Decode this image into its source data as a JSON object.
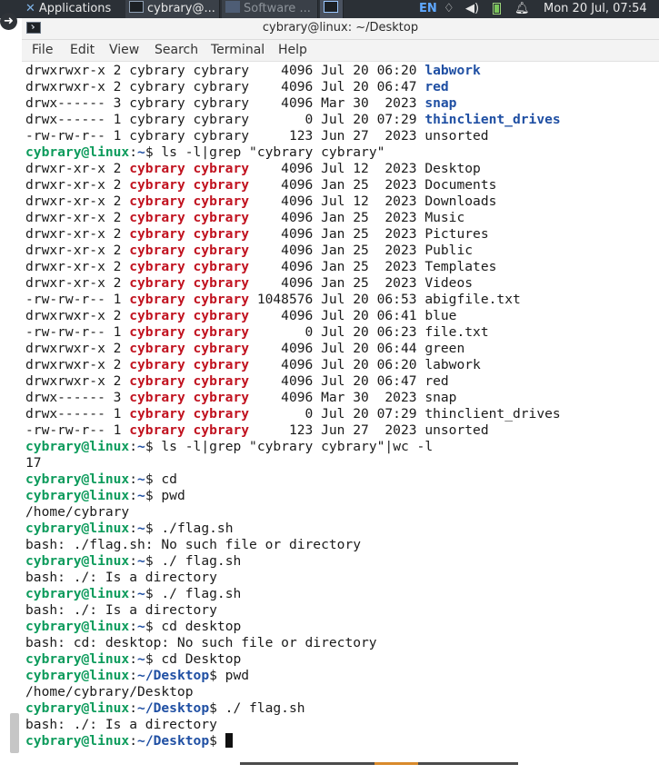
{
  "panel": {
    "applications_label": "Applications",
    "tasks": [
      {
        "label": "cybrary@..."
      },
      {
        "label": "Software ..."
      },
      {
        "label": ""
      }
    ],
    "keyboard_layout": "EN",
    "clock": "Mon 20 Jul, 07:54",
    "icons": [
      "xfce-logo-icon",
      "network-icon",
      "volume-icon",
      "battery-icon",
      "notification-bell-icon"
    ]
  },
  "window": {
    "title": "cybrary@linux: ~/Desktop",
    "menu": [
      "File",
      "Edit",
      "View",
      "Search",
      "Terminal",
      "Help"
    ]
  },
  "terminal": {
    "prompt_user": "cybrary@linux",
    "lines": [
      [
        {
          "t": "drwxrwxr-x 2 cybrary cybrary    4096 Jul 20 06:20 "
        },
        {
          "t": "labwork",
          "c": "dir"
        }
      ],
      [
        {
          "t": "drwxrwxr-x 2 cybrary cybrary    4096 Jul 20 06:47 "
        },
        {
          "t": "red",
          "c": "dir"
        }
      ],
      [
        {
          "t": "drwx------ 3 cybrary cybrary    4096 Mar 30  2023 "
        },
        {
          "t": "snap",
          "c": "dir"
        }
      ],
      [
        {
          "t": "drwx------ 1 cybrary cybrary       0 Jul 20 07:29 "
        },
        {
          "t": "thinclient_drives",
          "c": "dir"
        }
      ],
      [
        {
          "t": "-rw-rw-r-- 1 cybrary cybrary     123 Jun 27  2023 unsorted"
        }
      ],
      [
        {
          "t": "cybrary@linux",
          "c": "user"
        },
        {
          "t": ":"
        },
        {
          "t": "~",
          "c": "path"
        },
        {
          "t": "$ ls -l|grep \"cybrary cybrary\""
        }
      ],
      [
        {
          "t": "drwxr-xr-x 2 "
        },
        {
          "t": "cybrary cybrary",
          "c": "hl"
        },
        {
          "t": "    4096 Jul 12  2023 Desktop"
        }
      ],
      [
        {
          "t": "drwxr-xr-x 2 "
        },
        {
          "t": "cybrary cybrary",
          "c": "hl"
        },
        {
          "t": "    4096 Jan 25  2023 Documents"
        }
      ],
      [
        {
          "t": "drwxr-xr-x 2 "
        },
        {
          "t": "cybrary cybrary",
          "c": "hl"
        },
        {
          "t": "    4096 Jul 12  2023 Downloads"
        }
      ],
      [
        {
          "t": "drwxr-xr-x 2 "
        },
        {
          "t": "cybrary cybrary",
          "c": "hl"
        },
        {
          "t": "    4096 Jan 25  2023 Music"
        }
      ],
      [
        {
          "t": "drwxr-xr-x 2 "
        },
        {
          "t": "cybrary cybrary",
          "c": "hl"
        },
        {
          "t": "    4096 Jan 25  2023 Pictures"
        }
      ],
      [
        {
          "t": "drwxr-xr-x 2 "
        },
        {
          "t": "cybrary cybrary",
          "c": "hl"
        },
        {
          "t": "    4096 Jan 25  2023 Public"
        }
      ],
      [
        {
          "t": "drwxr-xr-x 2 "
        },
        {
          "t": "cybrary cybrary",
          "c": "hl"
        },
        {
          "t": "    4096 Jan 25  2023 Templates"
        }
      ],
      [
        {
          "t": "drwxr-xr-x 2 "
        },
        {
          "t": "cybrary cybrary",
          "c": "hl"
        },
        {
          "t": "    4096 Jan 25  2023 Videos"
        }
      ],
      [
        {
          "t": "-rw-rw-r-- 1 "
        },
        {
          "t": "cybrary cybrary",
          "c": "hl"
        },
        {
          "t": " 1048576 Jul 20 06:53 abigfile.txt"
        }
      ],
      [
        {
          "t": "drwxrwxr-x 2 "
        },
        {
          "t": "cybrary cybrary",
          "c": "hl"
        },
        {
          "t": "    4096 Jul 20 06:41 blue"
        }
      ],
      [
        {
          "t": "-rw-rw-r-- 1 "
        },
        {
          "t": "cybrary cybrary",
          "c": "hl"
        },
        {
          "t": "       0 Jul 20 06:23 file.txt"
        }
      ],
      [
        {
          "t": "drwxrwxr-x 2 "
        },
        {
          "t": "cybrary cybrary",
          "c": "hl"
        },
        {
          "t": "    4096 Jul 20 06:44 green"
        }
      ],
      [
        {
          "t": "drwxrwxr-x 2 "
        },
        {
          "t": "cybrary cybrary",
          "c": "hl"
        },
        {
          "t": "    4096 Jul 20 06:20 labwork"
        }
      ],
      [
        {
          "t": "drwxrwxr-x 2 "
        },
        {
          "t": "cybrary cybrary",
          "c": "hl"
        },
        {
          "t": "    4096 Jul 20 06:47 red"
        }
      ],
      [
        {
          "t": "drwx------ 3 "
        },
        {
          "t": "cybrary cybrary",
          "c": "hl"
        },
        {
          "t": "    4096 Mar 30  2023 snap"
        }
      ],
      [
        {
          "t": "drwx------ 1 "
        },
        {
          "t": "cybrary cybrary",
          "c": "hl"
        },
        {
          "t": "       0 Jul 20 07:29 thinclient_drives"
        }
      ],
      [
        {
          "t": "-rw-rw-r-- 1 "
        },
        {
          "t": "cybrary cybrary",
          "c": "hl"
        },
        {
          "t": "     123 Jun 27  2023 unsorted"
        }
      ],
      [
        {
          "t": "cybrary@linux",
          "c": "user"
        },
        {
          "t": ":"
        },
        {
          "t": "~",
          "c": "path"
        },
        {
          "t": "$ ls -l|grep \"cybrary cybrary\"|wc -l"
        }
      ],
      [
        {
          "t": "17"
        }
      ],
      [
        {
          "t": "cybrary@linux",
          "c": "user"
        },
        {
          "t": ":"
        },
        {
          "t": "~",
          "c": "path"
        },
        {
          "t": "$ cd"
        }
      ],
      [
        {
          "t": "cybrary@linux",
          "c": "user"
        },
        {
          "t": ":"
        },
        {
          "t": "~",
          "c": "path"
        },
        {
          "t": "$ pwd"
        }
      ],
      [
        {
          "t": "/home/cybrary"
        }
      ],
      [
        {
          "t": "cybrary@linux",
          "c": "user"
        },
        {
          "t": ":"
        },
        {
          "t": "~",
          "c": "path"
        },
        {
          "t": "$ ./flag.sh"
        }
      ],
      [
        {
          "t": "bash: ./flag.sh: No such file or directory"
        }
      ],
      [
        {
          "t": "cybrary@linux",
          "c": "user"
        },
        {
          "t": ":"
        },
        {
          "t": "~",
          "c": "path"
        },
        {
          "t": "$ ./ flag.sh"
        }
      ],
      [
        {
          "t": "bash: ./: Is a directory"
        }
      ],
      [
        {
          "t": "cybrary@linux",
          "c": "user"
        },
        {
          "t": ":"
        },
        {
          "t": "~",
          "c": "path"
        },
        {
          "t": "$ ./ flag.sh"
        }
      ],
      [
        {
          "t": "bash: ./: Is a directory"
        }
      ],
      [
        {
          "t": "cybrary@linux",
          "c": "user"
        },
        {
          "t": ":"
        },
        {
          "t": "~",
          "c": "path"
        },
        {
          "t": "$ cd desktop"
        }
      ],
      [
        {
          "t": "bash: cd: desktop: No such file or directory"
        }
      ],
      [
        {
          "t": "cybrary@linux",
          "c": "user"
        },
        {
          "t": ":"
        },
        {
          "t": "~",
          "c": "path"
        },
        {
          "t": "$ cd Desktop"
        }
      ],
      [
        {
          "t": "cybrary@linux",
          "c": "user"
        },
        {
          "t": ":"
        },
        {
          "t": "~/Desktop",
          "c": "path"
        },
        {
          "t": "$ pwd"
        }
      ],
      [
        {
          "t": "/home/cybrary/Desktop"
        }
      ],
      [
        {
          "t": "cybrary@linux",
          "c": "user"
        },
        {
          "t": ":"
        },
        {
          "t": "~/Desktop",
          "c": "path"
        },
        {
          "t": "$ ./ flag.sh"
        }
      ],
      [
        {
          "t": "bash: ./: Is a directory"
        }
      ],
      [
        {
          "t": "cybrary@linux",
          "c": "user"
        },
        {
          "t": ":"
        },
        {
          "t": "~/Desktop",
          "c": "path"
        },
        {
          "t": "$ "
        },
        {
          "cursor": true
        }
      ]
    ]
  },
  "colors": {
    "prompt_user": "#0d9b5c",
    "prompt_path": "#1f4fa3",
    "grep_match": "#c1121f",
    "panel_bg": "#2b3036"
  }
}
